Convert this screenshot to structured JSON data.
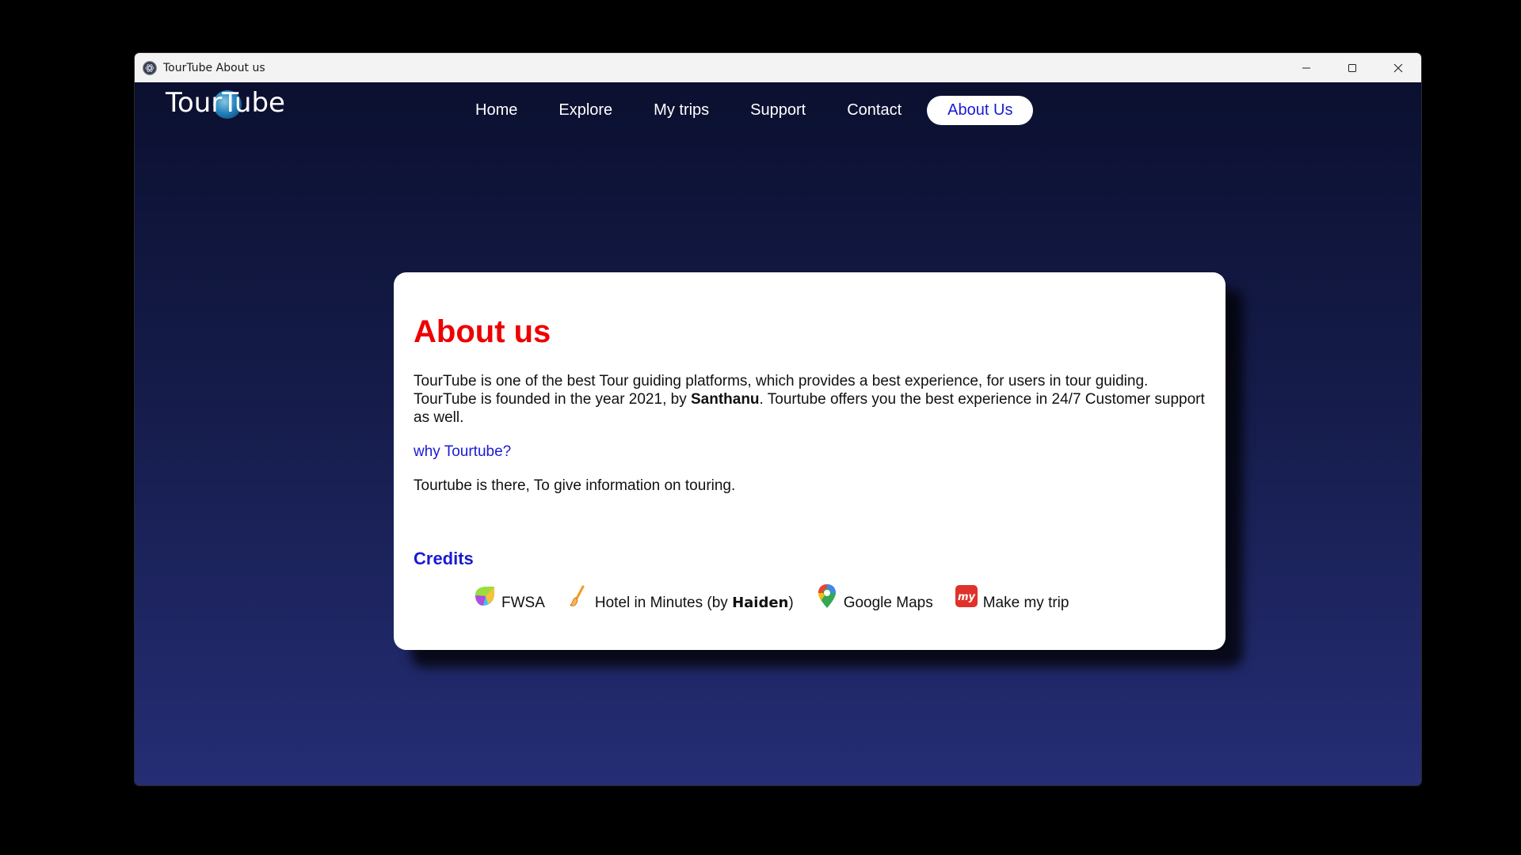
{
  "window": {
    "title": "TourTube About us",
    "app_icon": "electron-icon",
    "controls": [
      "minimize-icon",
      "maximize-icon",
      "close-icon"
    ]
  },
  "header": {
    "logo_text": "TourTube",
    "nav": [
      {
        "label": "Home",
        "active": false
      },
      {
        "label": "Explore",
        "active": false
      },
      {
        "label": "My trips",
        "active": false
      },
      {
        "label": "Support",
        "active": false
      },
      {
        "label": "Contact",
        "active": false
      },
      {
        "label": "About Us",
        "active": true
      }
    ]
  },
  "about": {
    "title": "About us",
    "para_1": "TourTube is one of the best Tour guiding platforms, which provides a best experience, for users in tour guiding. TourTube is founded in the year 2021, by ",
    "founder": "Santhanu",
    "para_2": ". Tourtube offers you the best experience in 24/7 Customer support as well.",
    "why_link": "why Tourtube?",
    "why_text": "Tourtube is there, To give information on touring."
  },
  "credits": {
    "heading": "Credits",
    "items": [
      {
        "icon": "fwsa-leaf-icon",
        "label": "FWSA"
      },
      {
        "icon": "brush-icon",
        "label_prefix": "Hotel in Minutes (by ",
        "label_bold": "Haiden",
        "label_suffix": ")"
      },
      {
        "icon": "map-pin-icon",
        "label": "Google Maps"
      },
      {
        "icon": "makemytrip-icon",
        "label": "Make my trip"
      }
    ]
  },
  "colors": {
    "title_red": "#ee0000",
    "link_blue": "#1a1ad4",
    "background_top": "#0b1030",
    "background_bottom": "#252d75"
  }
}
